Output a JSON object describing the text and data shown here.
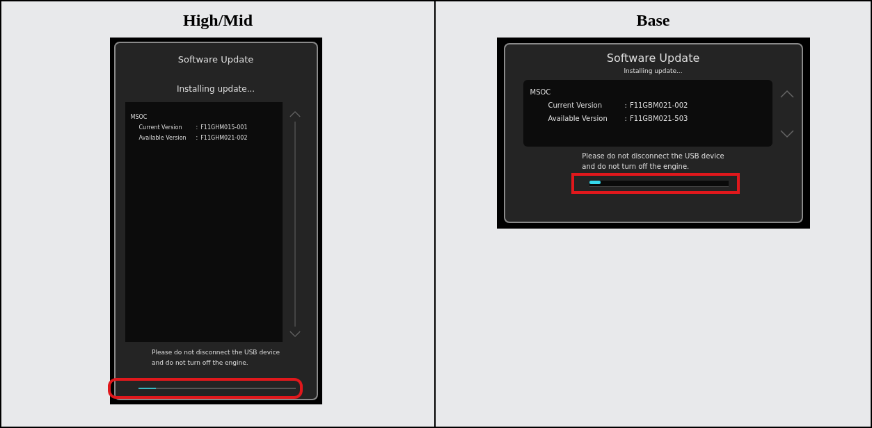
{
  "panels": [
    {
      "heading": "High/Mid",
      "kind": "portrait",
      "screen": {
        "title": "Software Update",
        "status": "Installing update...",
        "module": "MSOC",
        "versions": [
          {
            "label": "Current Version",
            "separator": ":",
            "value": "F11GHM015-001"
          },
          {
            "label": "Available Version",
            "separator": ":",
            "value": "F11GHM021-002"
          }
        ],
        "warning_lines": [
          "Please do not disconnect the USB device",
          "and do not turn off the engine."
        ],
        "progress": {
          "level": 0.11,
          "highlighted": true
        }
      }
    },
    {
      "heading": "Base",
      "kind": "landscape",
      "screen": {
        "title": "Software Update",
        "status": "Installing update...",
        "module": "MSOC",
        "versions": [
          {
            "label": "Current Version",
            "separator": ":",
            "value": "F11GBM021-002"
          },
          {
            "label": "Available Version",
            "separator": ":",
            "value": "F11GBM021-503"
          }
        ],
        "warning_lines": [
          "Please do not disconnect the USB device",
          "and do not turn off the engine."
        ],
        "progress": {
          "level": 0.08,
          "highlighted": true
        }
      }
    }
  ]
}
